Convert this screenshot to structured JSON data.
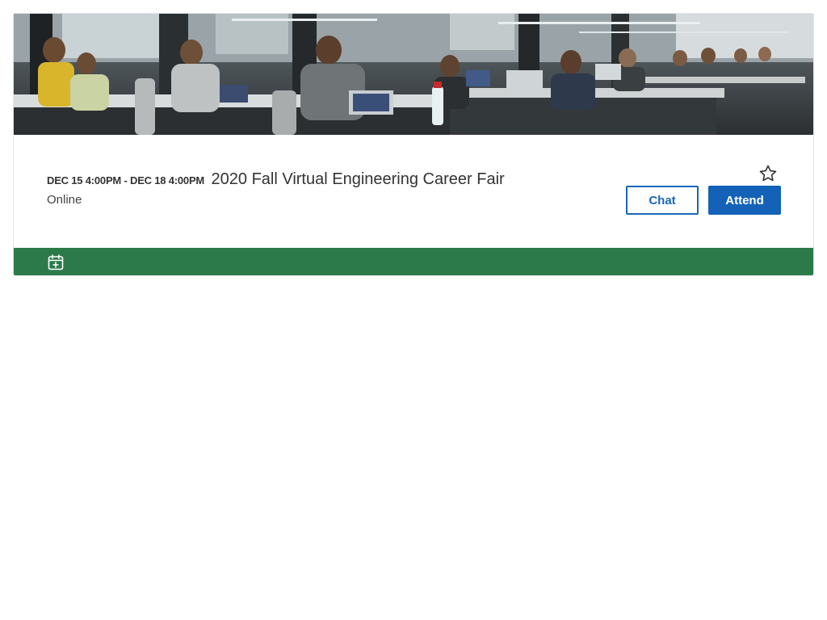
{
  "event": {
    "date_range": "DEC 15 4:00PM - DEC 18 4:00PM",
    "title": "2020 Fall Virtual Engineering Career Fair",
    "location": "Online"
  },
  "actions": {
    "chat_label": "Chat",
    "attend_label": "Attend"
  },
  "icons": {
    "favorite": "star-outline-icon",
    "calendar": "calendar-add-icon"
  },
  "colors": {
    "primary": "#1362b7",
    "footer": "#2c7a4a",
    "text": "#333333"
  }
}
